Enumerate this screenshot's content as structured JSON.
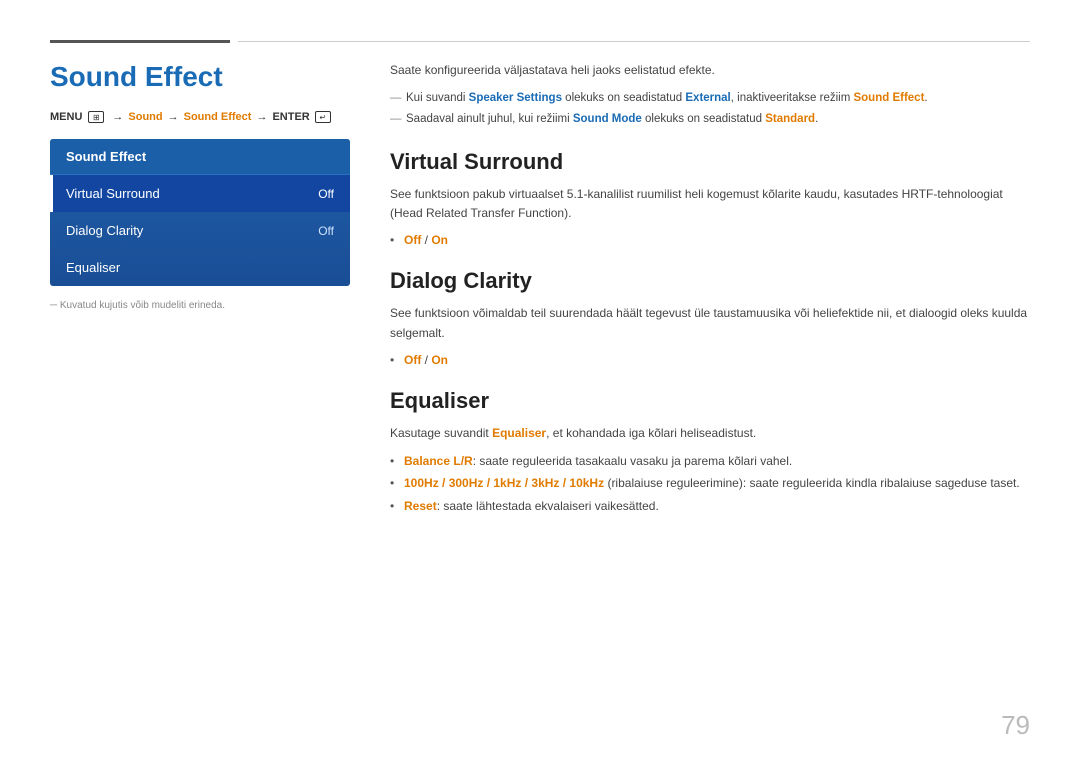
{
  "page": {
    "number": "79"
  },
  "header": {
    "title": "Sound Effect"
  },
  "menu_path": {
    "menu": "MENU",
    "sep1": "→",
    "item1": "Sound",
    "sep2": "→",
    "item2": "Sound Effect",
    "sep3": "→",
    "item3": "ENTER"
  },
  "menu_panel": {
    "title": "Sound Effect",
    "items": [
      {
        "label": "Virtual Surround",
        "value": "Off",
        "active": true
      },
      {
        "label": "Dialog Clarity",
        "value": "Off",
        "active": false
      },
      {
        "label": "Equaliser",
        "value": "",
        "active": false
      }
    ]
  },
  "footnote": "Kuvatud kujutis võib mudeliti erineda.",
  "intro": {
    "text": "Saate konfigureerida väljastatava heli jaoks eelistatud efekte.",
    "bullets": [
      {
        "prefix": "Kui suvandi ",
        "link1": "Speaker Settings",
        "middle": " olekuks on seadistatud ",
        "link2": "External",
        "suffix": ", inaktiveeritakse režiim ",
        "link3": "Sound Effect",
        "end": "."
      },
      {
        "prefix": "Saadaval ainult juhul, kui režiimi ",
        "link1": "Sound Mode",
        "middle": " olekuks on seadistatud ",
        "link2": "Standard",
        "end": "."
      }
    ]
  },
  "sections": {
    "virtual_surround": {
      "title": "Virtual Surround",
      "desc": "See funktsioon pakub virtuaalset 5.1-kanalilist ruumilist heli kogemust kõlarite kaudu, kasutades HRTF-tehnoloogiat (Head Related Transfer Function).",
      "bullet": "Off / On"
    },
    "dialog_clarity": {
      "title": "Dialog Clarity",
      "desc": "See funktsioon võimaldab teil suurendada häält tegevust üle taustamuusika või heliefektide nii, et dialoogid oleks kuulda selgemalt.",
      "bullet": "Off / On"
    },
    "equaliser": {
      "title": "Equaliser",
      "desc_prefix": "Kasutage suvandit ",
      "desc_link": "Equaliser",
      "desc_suffix": ", et kohandada iga kõlari heliseadistust.",
      "bullets": [
        {
          "prefix": "",
          "link": "Balance L/R",
          "suffix": ": saate reguleerida tasakaalu vasaku ja parema kõlari vahel."
        },
        {
          "prefix": "",
          "link": "100Hz / 300Hz / 1kHz / 3kHz / 10kHz",
          "suffix": " (ribalaiuse reguleerimine): saate reguleerida kindla ribalaiuse sageduse taset."
        },
        {
          "prefix": "",
          "link": "Reset",
          "suffix": ": saate lähtestada ekvalaiseri vaikesätted."
        }
      ]
    }
  }
}
